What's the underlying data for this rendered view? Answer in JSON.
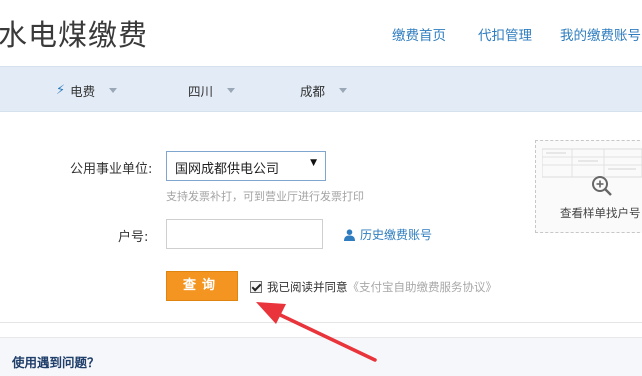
{
  "header": {
    "title": "水电煤缴费",
    "nav": [
      "缴费首页",
      "代扣管理",
      "我的缴费账号"
    ]
  },
  "filters": [
    {
      "label": "电费",
      "icon": "lightning-icon"
    },
    {
      "label": "四川"
    },
    {
      "label": "成都"
    }
  ],
  "form": {
    "unit_label": "公用事业单位:",
    "unit_value": "国网成都供电公司",
    "unit_hint": "支持发票补打，可到营业厅进行发票打印",
    "account_label": "户号:",
    "account_value": "",
    "history_link": "历史缴费账号",
    "query_button": "查询",
    "agree_checked": true,
    "agree_text": "我已阅读并同意",
    "agree_link": "《支付宝自助缴费服务协议》"
  },
  "sample": {
    "label": "查看样单找户号"
  },
  "help": {
    "title": "使用遇到问题？"
  },
  "colors": {
    "accent": "#2f7dbf",
    "button": "#f39520",
    "annotation_arrow": "#e8343a"
  }
}
